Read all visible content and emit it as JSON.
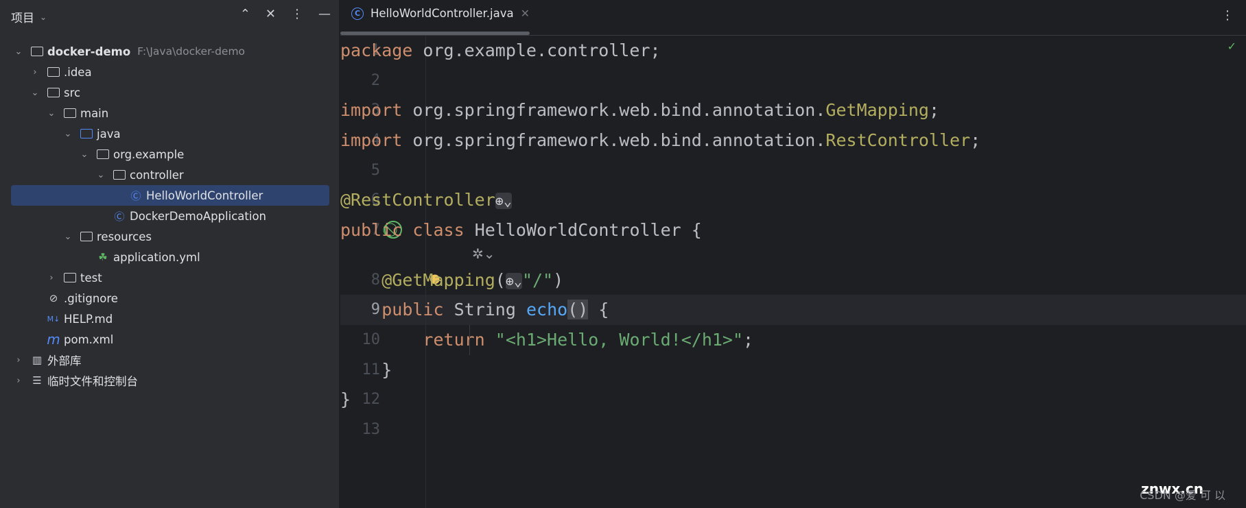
{
  "sidebar": {
    "title": "项目",
    "tools": [
      "expand-all-icon",
      "collapse-all-icon",
      "more-icon",
      "minimize-icon"
    ],
    "items": [
      {
        "label": "docker-demo",
        "path": "F:\\Java\\docker-demo",
        "depth": 0,
        "chevron": "down",
        "icon": "module-folder-icon"
      },
      {
        "label": ".idea",
        "depth": 1,
        "chevron": "right",
        "icon": "folder-icon"
      },
      {
        "label": "src",
        "depth": 1,
        "chevron": "down",
        "icon": "folder-icon"
      },
      {
        "label": "main",
        "depth": 2,
        "chevron": "down",
        "icon": "folder-icon"
      },
      {
        "label": "java",
        "depth": 3,
        "chevron": "down",
        "icon": "source-folder-icon"
      },
      {
        "label": "org.example",
        "depth": 4,
        "chevron": "down",
        "icon": "package-icon"
      },
      {
        "label": "controller",
        "depth": 5,
        "chevron": "down",
        "icon": "package-icon"
      },
      {
        "label": "HelloWorldController",
        "depth": 6,
        "icon": "class-icon",
        "selected": true
      },
      {
        "label": "DockerDemoApplication",
        "depth": 5,
        "icon": "spring-boot-class-icon"
      },
      {
        "label": "resources",
        "depth": 3,
        "chevron": "down",
        "icon": "resources-folder-icon"
      },
      {
        "label": "application.yml",
        "depth": 4,
        "icon": "spring-config-icon"
      },
      {
        "label": "test",
        "depth": 2,
        "chevron": "right",
        "icon": "folder-icon"
      },
      {
        "label": ".gitignore",
        "depth": 1,
        "icon": "gitignore-icon"
      },
      {
        "label": "HELP.md",
        "depth": 1,
        "icon": "markdown-icon"
      },
      {
        "label": "pom.xml",
        "depth": 1,
        "icon": "maven-icon"
      },
      {
        "label": "外部库",
        "depth": 0,
        "chevron": "right",
        "icon": "library-icon"
      },
      {
        "label": "临时文件和控制台",
        "depth": 0,
        "chevron": "right",
        "icon": "scratches-icon"
      }
    ]
  },
  "editor": {
    "tab": {
      "label": "HelloWorldController.java",
      "icon": "class-icon"
    },
    "current_line": 9,
    "line_numbers": [
      "1",
      "2",
      "3",
      "4",
      "5",
      "6",
      "7",
      "8",
      "9",
      "10",
      "11",
      "12",
      "13"
    ],
    "lines": {
      "l1": {
        "kw": "package",
        "rest": " org.example.controller;"
      },
      "l3": {
        "kw": "import",
        "rest": " org.springframework.web.bind.annotation.",
        "cls": "GetMapping",
        ";": ";"
      },
      "l4": {
        "kw": "import",
        "rest": " org.springframework.web.bind.annotation.",
        "cls": "RestController",
        "end": ";"
      },
      "l6": {
        "ann": "@RestController"
      },
      "l7": {
        "kw1": "public",
        "kw2": "class",
        "name": "HelloWorldController",
        "brace": "{"
      },
      "l8": {
        "ann": "@GetMapping",
        "open": "(",
        "str": "\"/\"",
        "close": ")"
      },
      "l9": {
        "kw": "public",
        "type": "String",
        "fn": "echo",
        "parens": "()",
        "brace": "{"
      },
      "l10": {
        "kw": "return",
        "str": "\"<h1>Hello, World!</h1>\"",
        "end": ";"
      },
      "l11": "}",
      "l12": "}"
    },
    "colors": {
      "keyword": "#cf8e6d",
      "annotation": "#b3ae60",
      "string": "#6aab73",
      "method": "#56a8f5"
    }
  },
  "watermark": {
    "text": "CSDN @爱 可 以",
    "site": "znwx.cn"
  }
}
